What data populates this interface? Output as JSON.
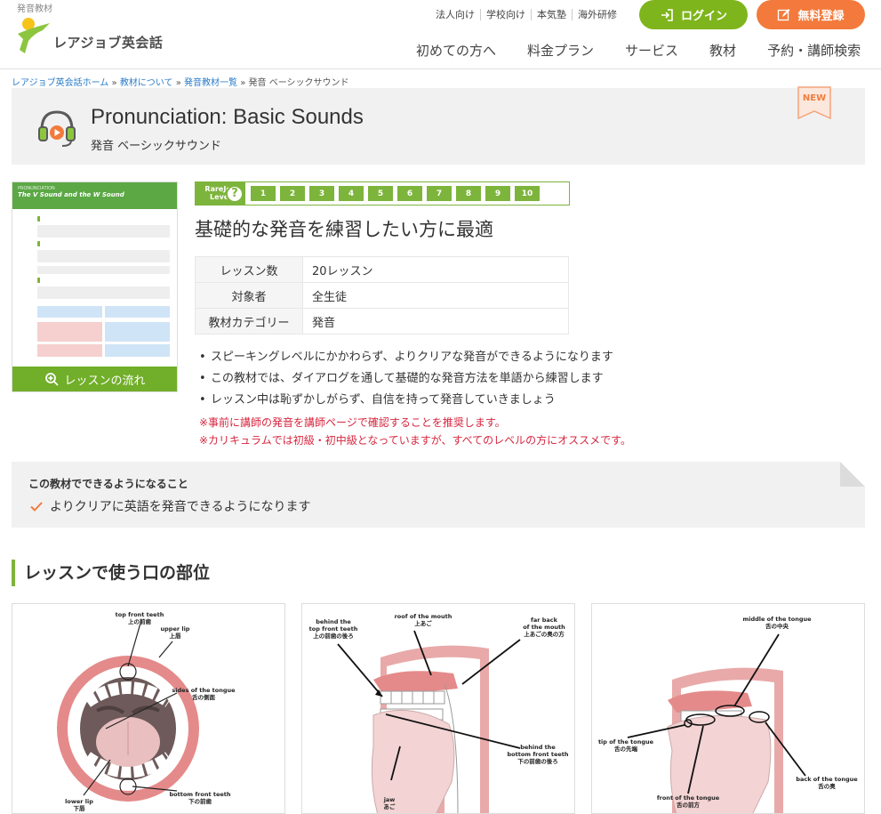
{
  "header": {
    "logo_caption": "発音教材",
    "logo_text": "レアジョブ英会話",
    "top_links": [
      "法人向け",
      "学校向け",
      "本気塾",
      "海外研修"
    ],
    "login_label": "ログイン",
    "register_label": "無料登録",
    "nav": [
      "初めての方へ",
      "料金プラン",
      "サービス",
      "教材",
      "予約・講師検索"
    ]
  },
  "breadcrumb": {
    "items": [
      "レアジョブ英会話ホーム",
      "教材について",
      "発音教材一覧"
    ],
    "current": "発音 ベーシックサウンド",
    "sep": "»"
  },
  "title": {
    "main": "Pronunciation: Basic Sounds",
    "sub": "発音 ベーシックサウンド",
    "badge": "NEW"
  },
  "thumbnail": {
    "flow_label": "レッスンの流れ",
    "header_text": "The V Sound and the W Sound"
  },
  "level": {
    "label_line1": "RareJob",
    "label_line2": "Level",
    "help": "?",
    "levels": [
      "1",
      "2",
      "3",
      "4",
      "5",
      "6",
      "7",
      "8",
      "9",
      "10"
    ]
  },
  "lead": "基礎的な発音を練習したい方に最適",
  "info_table": [
    {
      "key": "レッスン数",
      "value": "20レッスン"
    },
    {
      "key": "対象者",
      "value": "全生徒"
    },
    {
      "key": "教材カテゴリー",
      "value": "発音"
    }
  ],
  "bullets": [
    "スピーキングレベルにかかわらず、よりクリアな発音ができるようになります",
    "この教材では、ダイアログを通して基礎的な発音方法を単語から練習します",
    "レッスン中は恥ずかしがらず、自信を持って発音していきましょう"
  ],
  "notes": [
    "※事前に講師の発音を講師ページで確認することを推奨します。",
    "※カリキュラムでは初級・初中級となっていますが、すべてのレベルの方にオススメです。"
  ],
  "can_do": {
    "title": "この教材でできるようになること",
    "item": "よりクリアに英語を発音できるようになります"
  },
  "section_heading": "レッスンで使う口の部位",
  "diagrams": {
    "front": {
      "top_teeth_en": "top front teeth",
      "top_teeth_jp": "上の前歯",
      "upper_lip_en": "upper lip",
      "upper_lip_jp": "上唇",
      "sides_en": "sides of the tongue",
      "sides_jp": "舌の側面",
      "bottom_teeth_en": "bottom front teeth",
      "bottom_teeth_jp": "下の前歯",
      "lower_lip_en": "lower lip",
      "lower_lip_jp": "下唇"
    },
    "side1": {
      "behind_top_en1": "behind the",
      "behind_top_en2": "top front teeth",
      "behind_top_jp": "上の前歯の後ろ",
      "roof_en": "roof of the mouth",
      "roof_jp": "上あご",
      "far_back_en1": "far back",
      "far_back_en2": "of the mouth",
      "far_back_jp": "上あごの奥の方",
      "behind_bottom_en1": "behind the",
      "behind_bottom_en2": "bottom front teeth",
      "behind_bottom_jp": "下の前歯の後ろ",
      "jaw_en": "jaw",
      "jaw_jp": "あご"
    },
    "side2": {
      "middle_en": "middle of the tongue",
      "middle_jp": "舌の中央",
      "tip_en": "tip of the tongue",
      "tip_jp": "舌の先端",
      "back_en": "back of the tongue",
      "back_jp": "舌の奥",
      "front_en": "front of the tongue",
      "front_jp": "舌の前方"
    }
  },
  "colors": {
    "accent_green": "#7db43c",
    "register_orange": "#f37a3c",
    "note_red": "#d6263f",
    "link_blue": "#2b7dc9"
  }
}
